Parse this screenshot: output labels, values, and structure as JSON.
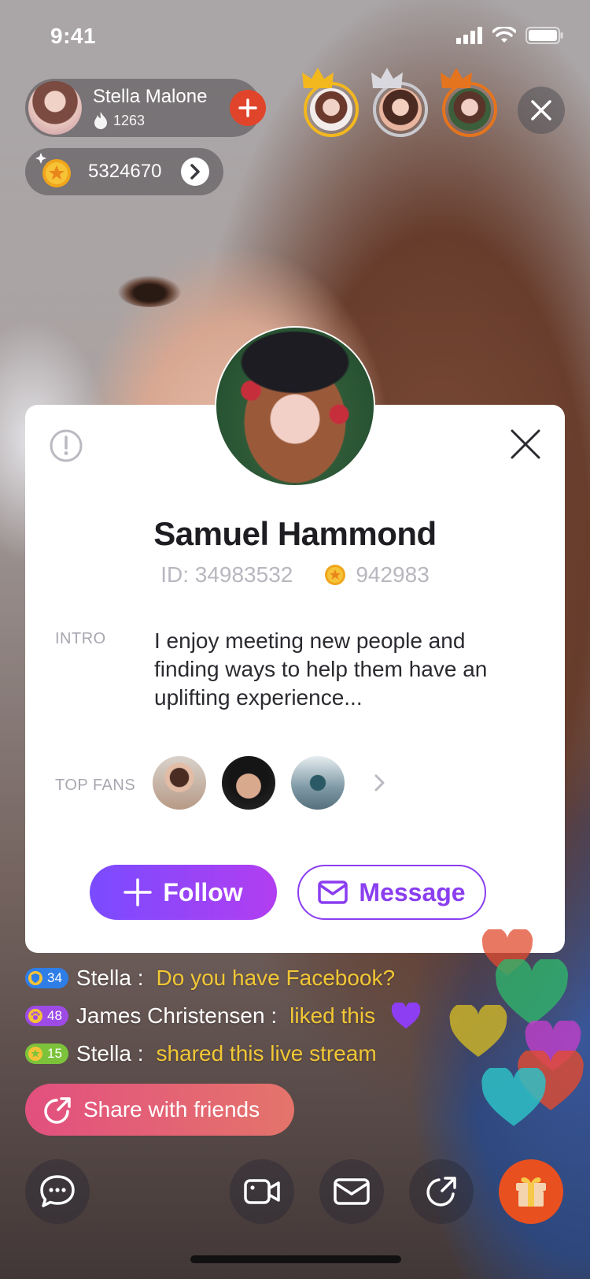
{
  "status_bar": {
    "time": "9:41"
  },
  "host": {
    "name": "Stella Malone",
    "likes": "1263"
  },
  "coins": {
    "count": "5324670"
  },
  "profile": {
    "name": "Samuel Hammond",
    "id_text": "ID: 34983532",
    "coins": "942983",
    "intro_label": "INTRO",
    "intro": "I enjoy meeting new people and finding ways to help them have an uplifting experience...",
    "top_fans_label": "TOP FANS",
    "follow_label": "Follow",
    "message_label": "Message"
  },
  "chat": [
    {
      "level": "34",
      "level_color": "#2f7ee8",
      "name": "Stella :",
      "message": "Do you have Facebook?"
    },
    {
      "level": "48",
      "level_color": "#9e4be6",
      "name": "James Christensen :",
      "message": "liked this"
    },
    {
      "level": "15",
      "level_color": "#7cc33b",
      "name": "Stella :",
      "message": "shared this live stream"
    }
  ],
  "share": {
    "label": "Share with friends"
  },
  "colors": {
    "accent_purple": "#8a3ef0",
    "gold_text": "#f2c735",
    "gift_orange": "#e8501f",
    "plus_red": "#e0442a"
  },
  "icons": {
    "report": "exclamation-circle-icon",
    "close": "close-icon",
    "coin": "star-coin-icon",
    "flame": "flame-icon",
    "crown": "crown-icon",
    "chat": "chat-bubble-icon",
    "video": "video-camera-icon",
    "mail": "mail-icon",
    "share": "share-icon",
    "gift": "gift-icon"
  }
}
